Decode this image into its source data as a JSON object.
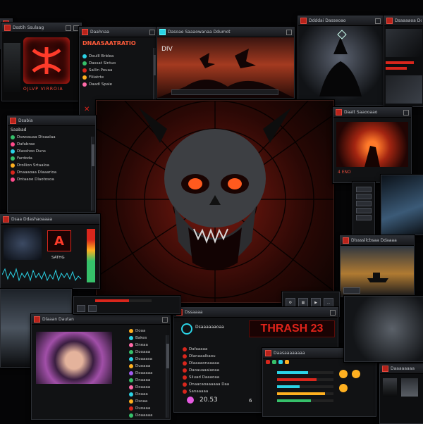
{
  "colors": {
    "accent": "#d8261c",
    "glow": "#ff5a1e",
    "panel": "#111214",
    "cyan": "#2bd3e6"
  },
  "windows": {
    "w_topleft_small": {
      "title": ""
    },
    "w_logo": {
      "title": "Dsstih Ssulaag",
      "caption": "OJLVP VIRROIA"
    },
    "w_chat": {
      "title": "Daahnaa",
      "header": "DNAASAATRATIO",
      "items": [
        "Doulll Brblea",
        "Dassat Sintuo",
        "Sallin Pouaa",
        "Fliiatrte",
        "Daadl Spaie"
      ]
    },
    "w_div": {
      "title": "Dasoae Saaaowanaa Ddumot",
      "label": "DIV"
    },
    "w_boss": {
      "title": "Ddddai Dasseoao"
    },
    "w_topright": {
      "title": "Dsaaaaoa Doa"
    },
    "w_list_left": {
      "title": "Dsabia",
      "header": "Saabad",
      "items": [
        "Dswoauaa Dtsaalaa",
        "Dafabrae",
        "Dlasshoo Duns",
        "Fardoda",
        "Drollion Srtaaloa",
        "Dnaaaoaa Dlaaarioa",
        "Dntaaoe Dlaotosoa"
      ]
    },
    "w_center": {
      "title": ""
    },
    "w_sunset": {
      "title": "Daalt Saaooaao",
      "caption": "4 ENO"
    },
    "w_logo2": {
      "title": "Dsaa Ddashaoaaaa",
      "caption": "SATHG"
    },
    "w_boat": {
      "title": "Dlssssllcbsaa Ddaaaa"
    },
    "w_stream": {
      "title": "Dlaaan Dautan",
      "items": [
        "Doaa",
        "Bakes",
        "Dneaa",
        "Dooaaa",
        "Doaaasa",
        "Duoaaa",
        "Doaaaaa",
        "Dnaaaa",
        "Doaaaa",
        "Doaaa",
        "Dsoaa",
        "Duoaaa",
        "Doaaaaa"
      ]
    },
    "w_thrash": {
      "title": "Dssaaaa",
      "header": "Dsaaaaaaoaa",
      "game_title": "THRASH 23",
      "rows": [
        "Dafaaaaa",
        "Dlanaaalkaou",
        "Dlaaaaonaaaaa",
        "Daoauaaaiaoaa",
        "Sliuad Daaaoaa",
        "Dnaacaoaaaaaa Daa",
        "Sanaaaaa"
      ],
      "readout": "20.53",
      "badge": "6"
    },
    "w_mixer": {
      "title": "Daasaaaaaaaa"
    },
    "w_br": {
      "title": "Daaaaaaaa"
    }
  }
}
